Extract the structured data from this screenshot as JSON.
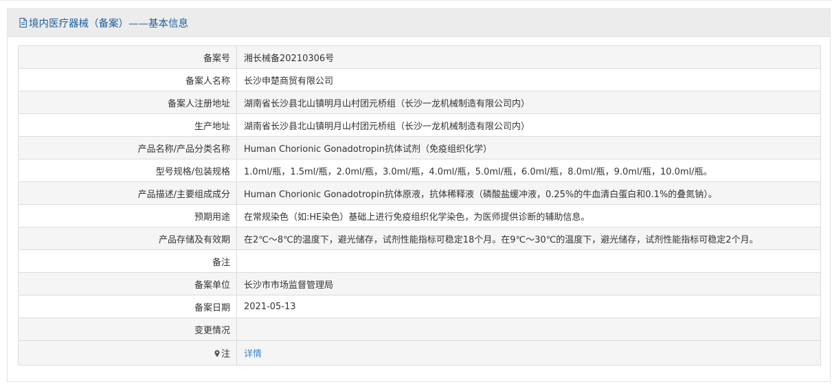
{
  "header": {
    "title": "境内医疗器械（备案）——基本信息"
  },
  "rows": [
    {
      "label": "备案号",
      "value": "湘长械备20210306号"
    },
    {
      "label": "备案人名称",
      "value": "长沙申楚商贸有限公司"
    },
    {
      "label": "备案人注册地址",
      "value": "湖南省长沙县北山镇明月山村团元桥组（长沙一龙机械制造有限公司内）"
    },
    {
      "label": "生产地址",
      "value": "湖南省长沙县北山镇明月山村团元桥组（长沙一龙机械制造有限公司内）"
    },
    {
      "label": "产品名称/产品分类名称",
      "value": "Human Chorionic Gonadotropin抗体试剂（免疫组织化学）"
    },
    {
      "label": "型号规格/包装规格",
      "value": "1.0ml/瓶，1.5ml/瓶，2.0ml/瓶，3.0ml/瓶，4.0ml/瓶，5.0ml/瓶，6.0ml/瓶，8.0ml/瓶，9.0ml/瓶，10.0ml/瓶。"
    },
    {
      "label": "产品描述/主要组成成分",
      "value": "Human Chorionic Gonadotropin抗体原液，抗体稀释液（磷酸盐缓冲液，0.25%的牛血清白蛋白和0.1%的叠氮钠）。"
    },
    {
      "label": "预期用途",
      "value": "在常规染色（如:HE染色）基础上进行免疫组织化学染色，为医师提供诊断的辅助信息。"
    },
    {
      "label": "产品存储及有效期",
      "value": "在2℃～8℃的温度下，避光储存，试剂性能指标可稳定18个月。在9℃～30℃的温度下，避光储存，试剂性能指标可稳定2个月。"
    },
    {
      "label": "备注",
      "value": ""
    },
    {
      "label": "备案单位",
      "value": "长沙市市场监督管理局"
    },
    {
      "label": "备案日期",
      "value": "2021-05-13"
    },
    {
      "label": "变更情况",
      "value": ""
    }
  ],
  "note": {
    "label": "注",
    "link_text": "详情",
    "icon": "map-pin-icon"
  },
  "colors": {
    "header_text": "#1e5e9e",
    "link": "#3a86d0",
    "row_alt": "#f5f5f5",
    "border": "#dcdcdc"
  }
}
